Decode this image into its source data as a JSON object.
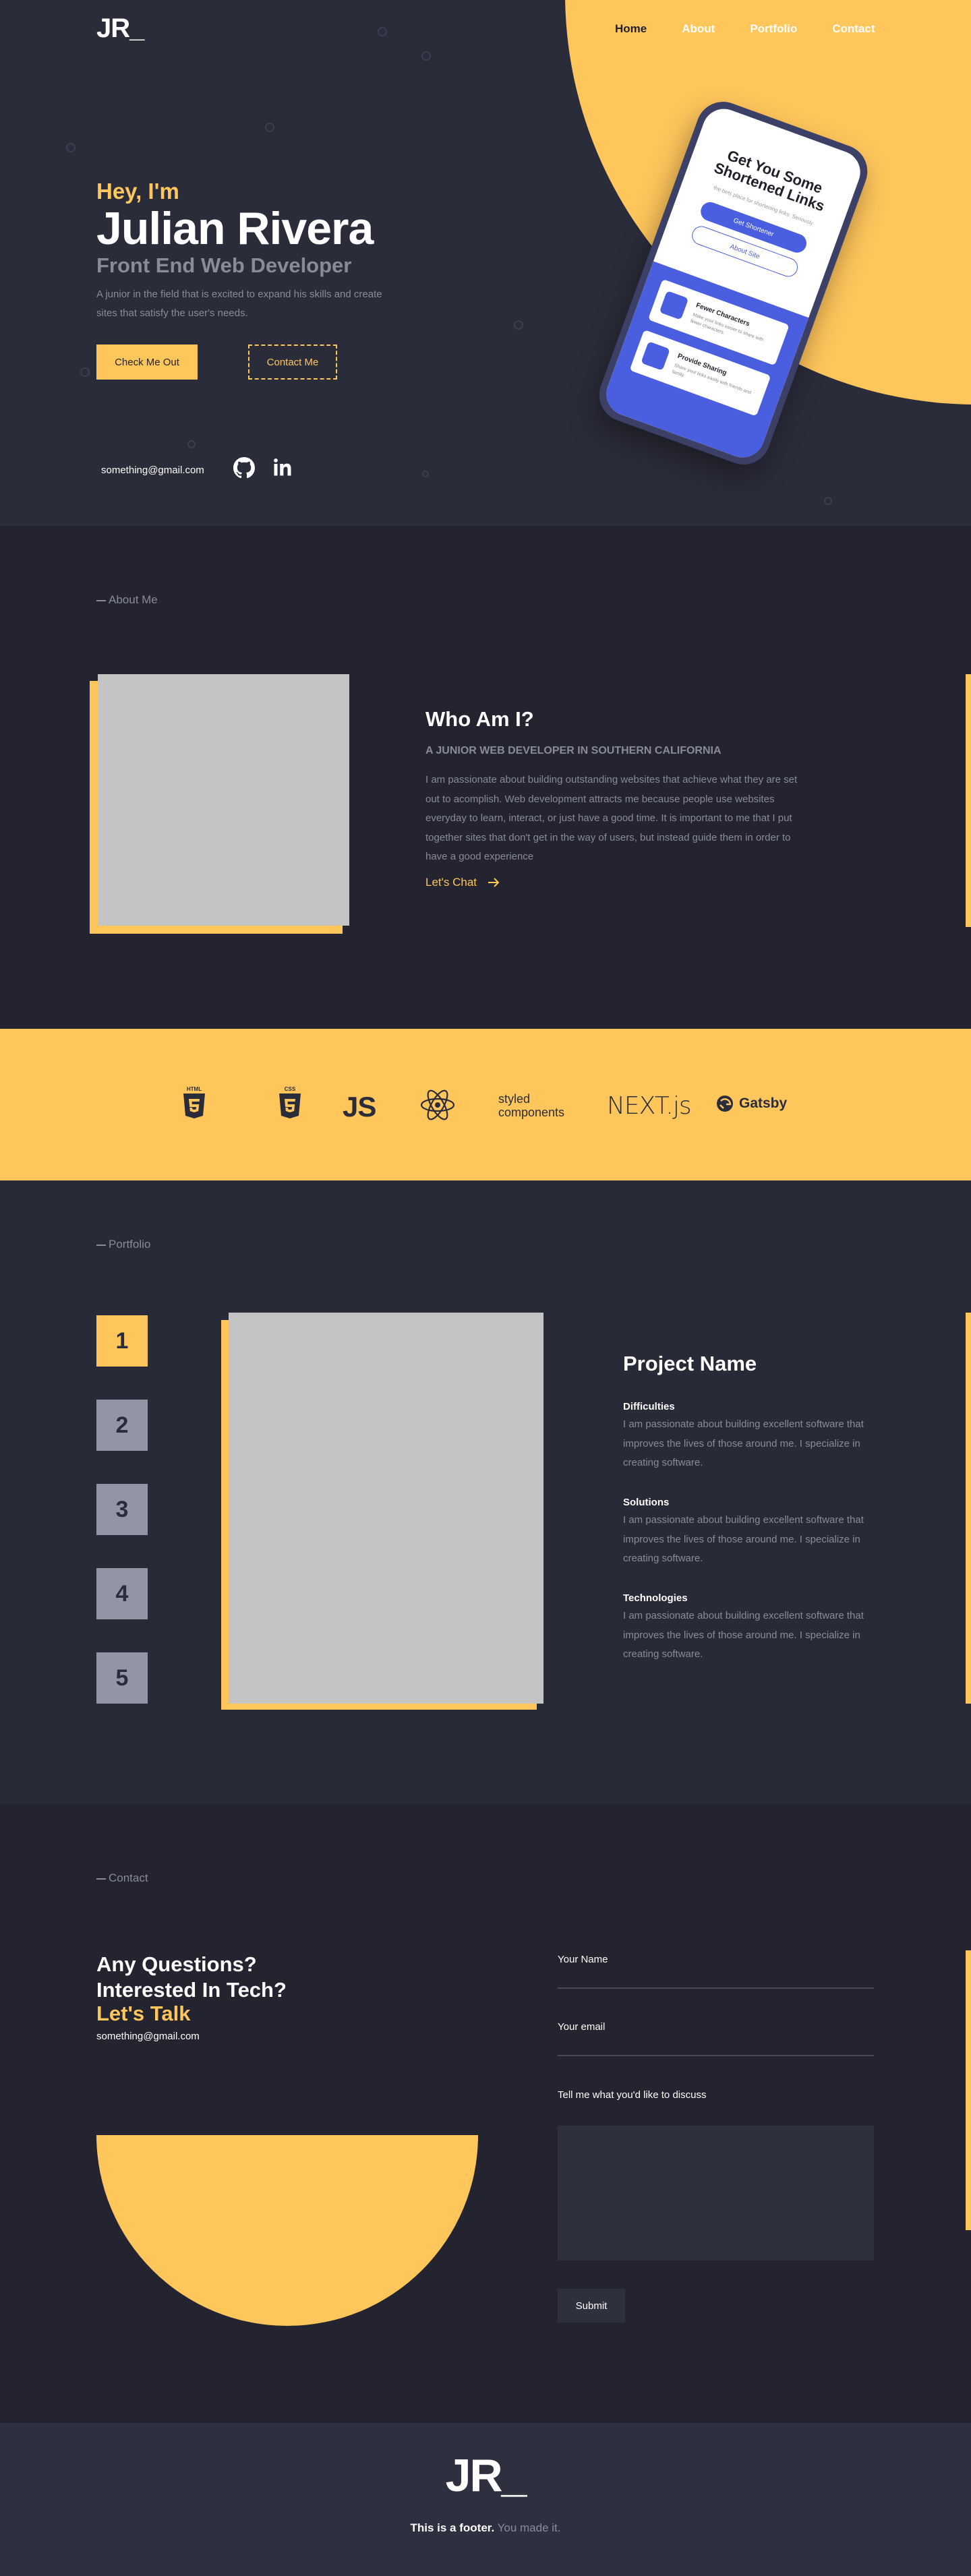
{
  "brand": {
    "logo": "JR_",
    "footer_logo": "JR_"
  },
  "nav": {
    "items": [
      "Home",
      "About",
      "Portfolio",
      "Contact"
    ]
  },
  "hero": {
    "greeting": "Hey, I'm",
    "name": "Julian Rivera",
    "role": "Front End Web Developer",
    "blurb": "A junior in the field that is excited to expand his skills and create sites that satisfy the user's needs.",
    "primary_btn": "Check Me Out",
    "secondary_btn": "Contact Me",
    "email": "something@gmail.com",
    "socials": [
      "github-icon",
      "linkedin-icon"
    ]
  },
  "phone_mock": {
    "title": "Get You Some Shortened Links",
    "subtitle": "the bets place for shortening links: Seriously",
    "btn1": "Get Shortener",
    "btn2": "About Site",
    "card1_title": "Fewer Characters",
    "card1_desc": "Make your links easier to share with fewer characters.",
    "card2_title": "Provide Sharing",
    "card2_desc": "Share your links easily with friends and family."
  },
  "about": {
    "tag": "About Me",
    "heading": "Who Am I?",
    "subheading": "A JUNIOR WEB DEVELOPER IN SOUTHERN CALIFORNIA",
    "body": "I am passionate about building outstanding websites that achieve what they are set out to acomplish. Web development attracts me because people use websites everyday to learn, interact, or just have a good time. It is important to me that I put together sites that don't get in the way of users, but instead guide them in order to have a good experience",
    "cta": "Let's Chat"
  },
  "tech": {
    "html": "HTML",
    "css": "CSS",
    "js": "JS",
    "styled": "styled components",
    "next": "NEXT.js",
    "gatsby": "Gatsby"
  },
  "portfolio": {
    "tag": "Portfolio",
    "numbers": [
      "1",
      "2",
      "3",
      "4",
      "5"
    ],
    "active_index": 0,
    "project_name": "Project Name",
    "sections": [
      {
        "title": "Difficulties",
        "body": "I am passionate about building excellent software that improves the lives of those around me. I specialize in creating software."
      },
      {
        "title": "Solutions",
        "body": "I am passionate about building excellent software that improves the lives of those around me. I specialize in creating software."
      },
      {
        "title": "Technologies",
        "body": "I am passionate about building excellent software that improves the lives of those around me. I specialize in creating software."
      }
    ]
  },
  "contact": {
    "tag": "Contact",
    "line1": "Any Questions?",
    "line2": "Interested In Tech?",
    "lets_talk": "Let's Talk",
    "email": "something@gmail.com",
    "name_label": "Your Name",
    "email_label": "Your email",
    "message_label": "Tell me what you'd like to discuss",
    "submit": "Submit"
  },
  "footer": {
    "bold": "This is a footer.",
    "muted": "You made it."
  },
  "colors": {
    "accent": "#ffc65c",
    "bg_dark": "#232430",
    "bg": "#292a37",
    "muted": "#8a8b99"
  }
}
